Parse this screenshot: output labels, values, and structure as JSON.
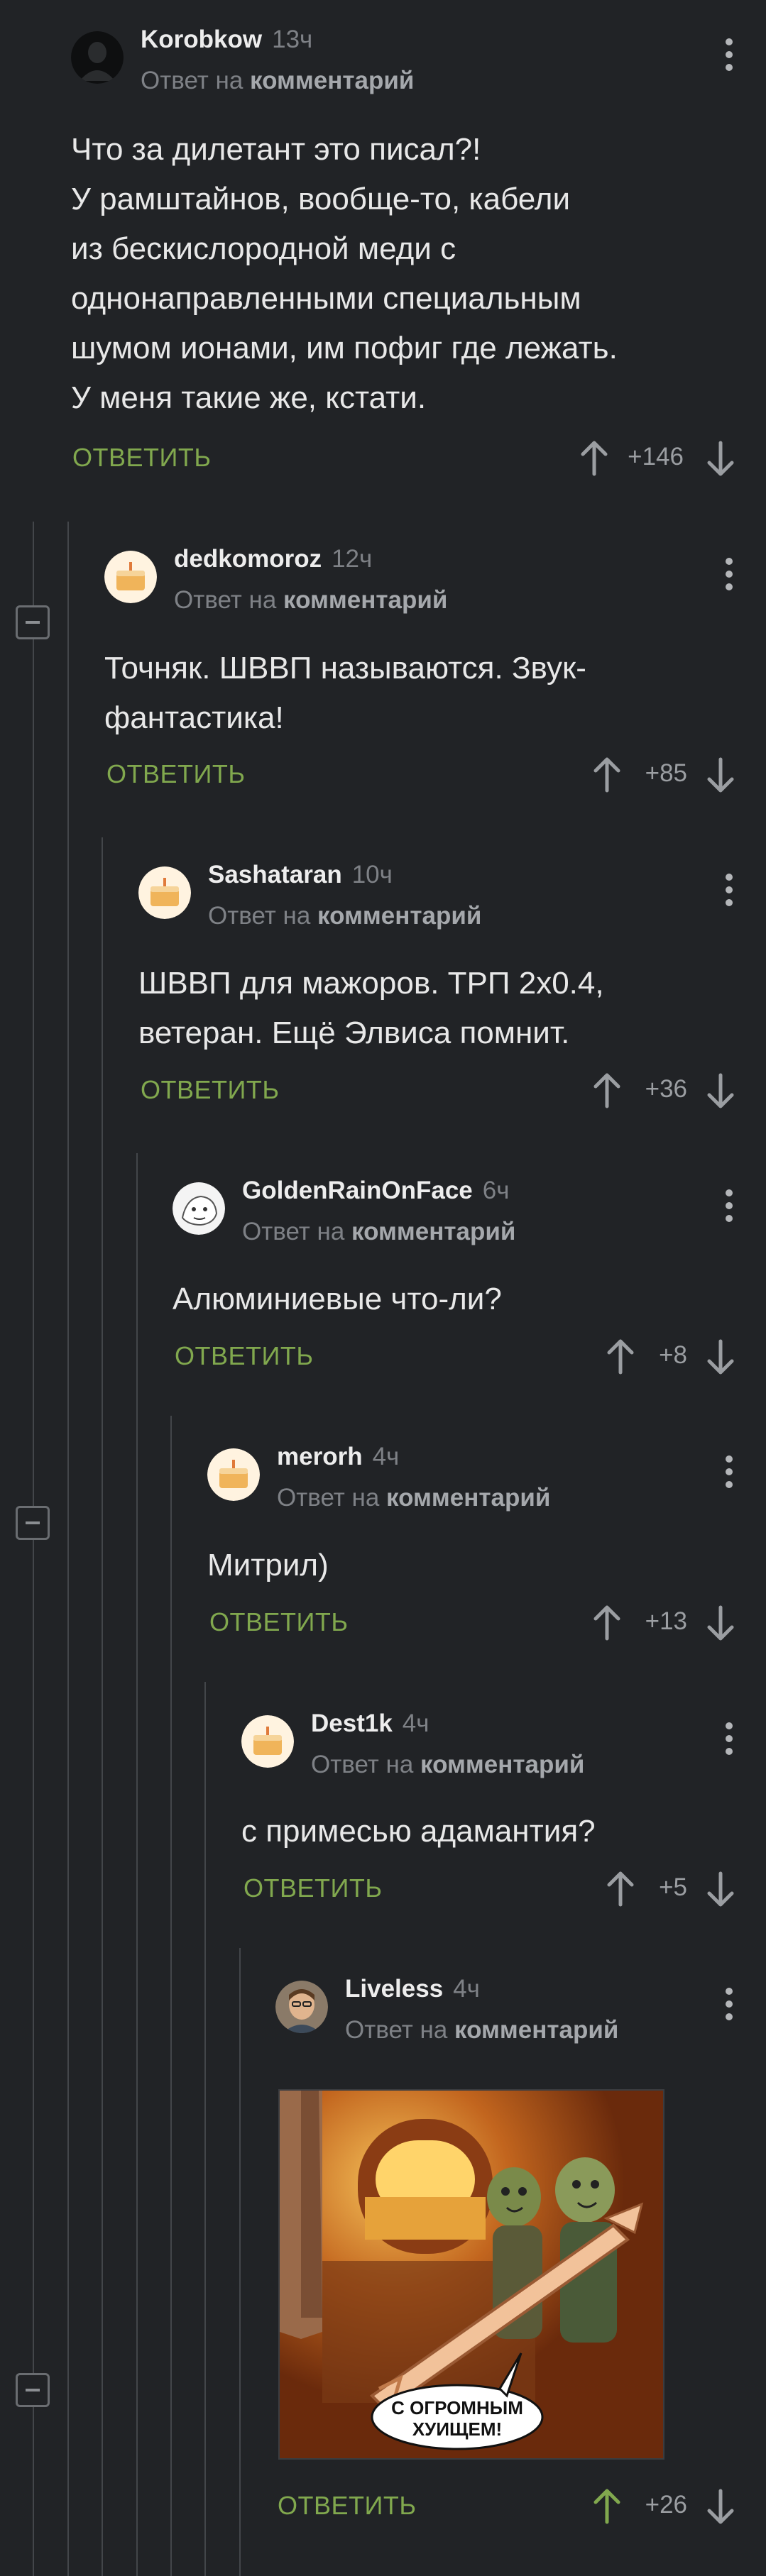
{
  "reply_to_text": "Ответ на",
  "reply_to_link": "комментарий",
  "reply_label": "ОТВЕТИТЬ",
  "colors": {
    "background": "#212326",
    "reply_green": "#81a84e",
    "upvoted_green": "#81a84e"
  },
  "comments": [
    {
      "author": "Korobkow",
      "time": "13ч",
      "lines": [
        "Что за дилетант это писал?!",
        "У рамштайнов, вообще-то, кабели",
        "из бескислородной меди с",
        "однонаправленными специальным",
        "шумом ионами, им пофиг где лежать.",
        "У меня такие же, кстати."
      ],
      "score": "+146",
      "avatar": "dark-silhouette-avatar"
    },
    {
      "author": "dedkomoroz",
      "time": "12ч",
      "lines": [
        "Точняк. ШВВП называются. Звук-",
        "фантастика!"
      ],
      "score": "+85",
      "avatar": "default-cake-avatar"
    },
    {
      "author": "Sashataran",
      "time": "10ч",
      "lines": [
        "ШВВП для мажоров. ТРП 2х0.4,",
        "ветеран. Ещё Элвиса помнит."
      ],
      "score": "+36",
      "avatar": "default-cake-avatar"
    },
    {
      "author": "GoldenRainOnFace",
      "time": "6ч",
      "lines": [
        "Алюминиевые что-ли?"
      ],
      "score": "+8",
      "avatar": "drawn-face-avatar"
    },
    {
      "author": "merorh",
      "time": "4ч",
      "lines": [
        "Митрил)"
      ],
      "score": "+13",
      "avatar": "default-cake-avatar"
    },
    {
      "author": "Dest1k",
      "time": "4ч",
      "lines": [
        "с примесью адамантия?"
      ],
      "score": "+5",
      "avatar": "default-cake-avatar"
    },
    {
      "author": "Liveless",
      "time": "4ч",
      "lines": [],
      "image_caption": [
        "С ОГРОМНЫМ",
        "ХУИЩЕМ!"
      ],
      "score": "+26",
      "upvoted": true,
      "avatar": "photo-avatar"
    }
  ]
}
